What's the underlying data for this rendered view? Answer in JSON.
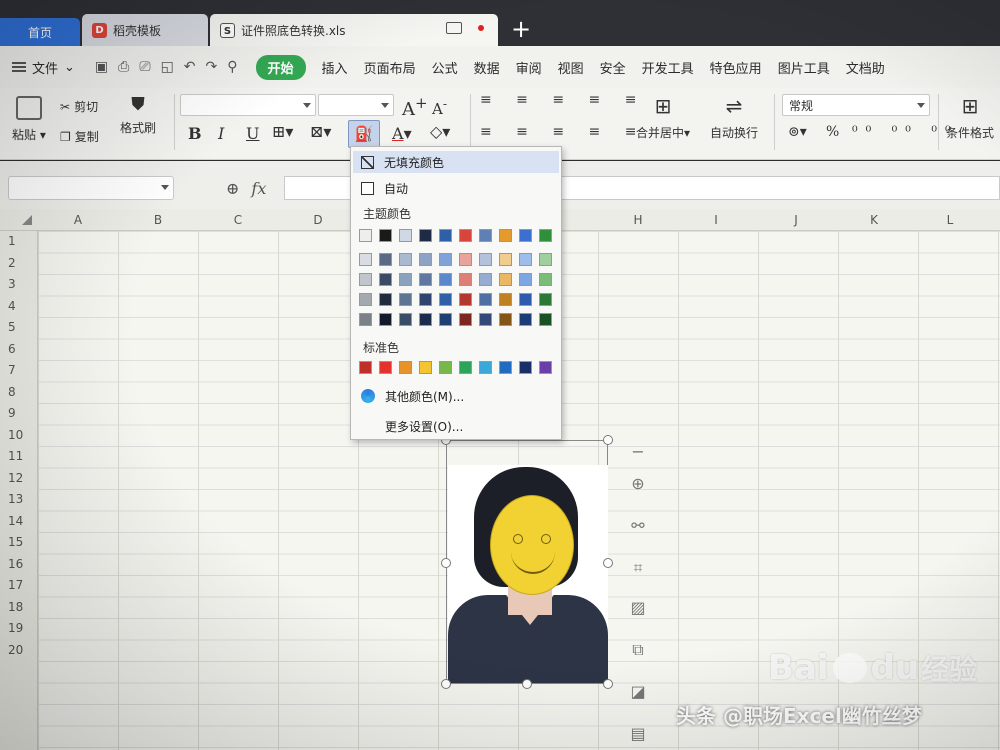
{
  "tabs": {
    "home": "首页",
    "template": "稻壳模板",
    "file": "证件照底色转换.xls",
    "add": "+"
  },
  "menubar": {
    "file": "文件",
    "items": [
      "开始",
      "插入",
      "页面布局",
      "公式",
      "数据",
      "审阅",
      "视图",
      "安全",
      "开发工具",
      "特色应用",
      "图片工具",
      "文档助"
    ],
    "active_index": 0,
    "active_color": "#34a853"
  },
  "ribbon": {
    "paste": "粘贴",
    "cut": "剪切",
    "copy": "复制",
    "format_painter": "格式刷",
    "bold": "B",
    "italic": "I",
    "underline": "U",
    "font_grow": "A",
    "font_shrink": "A",
    "font_color": "A",
    "merge_center": "合并居中",
    "wrap_text": "自动换行",
    "number_format": "常规",
    "percent": "%",
    "conditional_format": "条件格式"
  },
  "formula": {
    "fx": "fx"
  },
  "columns": [
    "A",
    "B",
    "C",
    "D",
    "H",
    "I",
    "J",
    "K",
    "L"
  ],
  "rows": [
    "1",
    "2",
    "3",
    "4",
    "5",
    "6",
    "7",
    "8",
    "9",
    "10",
    "11",
    "12",
    "13",
    "14",
    "15",
    "16",
    "17",
    "18",
    "19",
    "20"
  ],
  "fill_menu": {
    "no_fill": "无填充颜色",
    "auto": "自动",
    "theme_colors": "主题颜色",
    "standard_colors": "标准色",
    "more_colors": "其他颜色(M)...",
    "more_settings": "更多设置(O)...",
    "theme_top": [
      "#eeeeee",
      "#1a1a1a",
      "#cfd8e3",
      "#1f2a44",
      "#2f5fa7",
      "#d9453a",
      "#5f7fb5",
      "#e59a2c",
      "#3b6fd0",
      "#2f8f3b"
    ],
    "theme_shades": [
      [
        "#d9dde3",
        "#5a6a86",
        "#a9b9cf",
        "#8ea3c4",
        "#7fa2d8",
        "#e7a39c",
        "#b3c1dc",
        "#f0cc8e",
        "#9fbdeb",
        "#9fcf9c"
      ],
      [
        "#c1c6cd",
        "#3b4a65",
        "#8ba2bf",
        "#5f78a1",
        "#5b87cc",
        "#dd8176",
        "#97acd1",
        "#eab765",
        "#7ea6e3",
        "#7cbc79"
      ],
      [
        "#a4a9b0",
        "#202b40",
        "#5d7493",
        "#2f4570",
        "#2f5fa7",
        "#b3372e",
        "#4f6ea4",
        "#c1801f",
        "#2d5ab0",
        "#2a7a35"
      ],
      [
        "#7c8088",
        "#131a2a",
        "#394d68",
        "#1c2c4c",
        "#1e3f72",
        "#7d261f",
        "#34497a",
        "#835615",
        "#1c3c78",
        "#1b5224"
      ]
    ],
    "standard": [
      "#c0302a",
      "#e5322d",
      "#e8922a",
      "#f3c531",
      "#78b84a",
      "#2aa55a",
      "#3aa8d8",
      "#1f6cc0",
      "#1a2f6a",
      "#6b3fa8"
    ]
  },
  "watermark": {
    "brand_a": "Bai",
    "brand_b": "du",
    "brand_suffix": "经验",
    "credit": "头条 @职场Excel幽竹丝梦"
  }
}
